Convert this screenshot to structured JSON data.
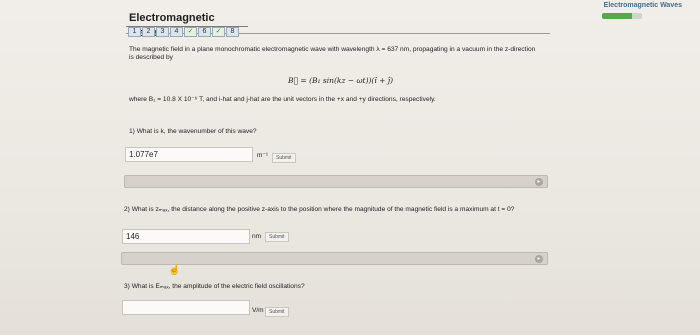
{
  "app": {
    "brand_title": "Electromagnetic Waves",
    "progress_fraction": 0.75
  },
  "header": {
    "title": "Electromagnetic Waves",
    "parts": [
      {
        "label": "1",
        "done": false
      },
      {
        "label": "2",
        "done": false
      },
      {
        "label": "3",
        "done": false
      },
      {
        "label": "4",
        "done": false
      },
      {
        "label": "✓",
        "done": true
      },
      {
        "label": "6",
        "done": false
      },
      {
        "label": "✓",
        "done": true
      },
      {
        "label": "8",
        "done": false
      }
    ]
  },
  "problem": {
    "intro": "The magnetic field in a plane monochromatic electromagnetic wave with wavelength λ = 637 nm, propagating in a vacuum in the z-direction is described by",
    "formula": "B⃗ = (B₁ sin(kz − ωt))(î + ĵ)",
    "where": "where B₁ = 10.8 X 10⁻⁶ T, and i-hat and j-hat are the unit vectors in the +x and +y directions, respectively."
  },
  "questions": [
    {
      "text": "1) What is k, the wavenumber of this wave?",
      "value": "1.077e7",
      "unit": "m⁻¹",
      "submit": "Submit"
    },
    {
      "text": "2) What is zₘₐₓ, the distance along the positive z-axis to the position where the magnitude of the magnetic field is a maximum at t = 0?",
      "value": "146",
      "unit": "nm",
      "submit": "Submit"
    },
    {
      "text": "3) What is Eₘₐₓ, the amplitude of the electric field oscillations?",
      "value": "",
      "unit": "V/m",
      "submit": "Submit"
    }
  ],
  "icons": {
    "feedback_toggle": "toggle-icon",
    "pointer": "hand-pointer-icon"
  }
}
